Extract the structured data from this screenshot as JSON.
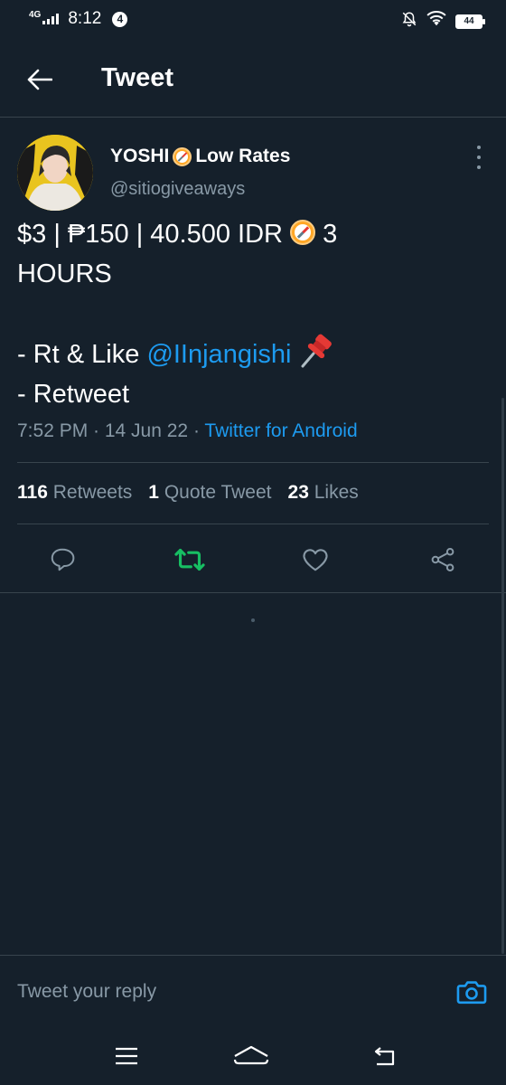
{
  "status_bar": {
    "network": "4G",
    "time": "8:12",
    "notification_count": "4",
    "battery": "44"
  },
  "header": {
    "title": "Tweet"
  },
  "tweet": {
    "display_name": "YOSHI",
    "display_name_suffix": "Low Rates",
    "handle": "@sitiogiveaways",
    "text_line1_a": "$3 | ₱150 | 40.500 IDR",
    "text_line1_b": "3",
    "text_line2": "HOURS",
    "text_line4_prefix": "- Rt & Like",
    "text_line4_mention": "@IInjangishi",
    "text_line5": "- Retweet",
    "timestamp": "7:52 PM · 14 Jun 22 · ",
    "source": "Twitter for Android"
  },
  "stats": {
    "retweets_count": "116",
    "retweets_label": "Retweets",
    "quotes_count": "1",
    "quotes_label": "Quote Tweet",
    "likes_count": "23",
    "likes_label": "Likes"
  },
  "actions": {
    "retweet_active_color": "#17bf63",
    "icon_color": "#8899a6",
    "icons": [
      "reply-icon",
      "retweet-icon",
      "like-icon",
      "share-icon"
    ]
  },
  "reply": {
    "placeholder": "Tweet your reply"
  },
  "colors": {
    "background": "#15202b",
    "accent": "#1d9bf0",
    "muted": "#8899a6",
    "divider": "#38444d"
  }
}
